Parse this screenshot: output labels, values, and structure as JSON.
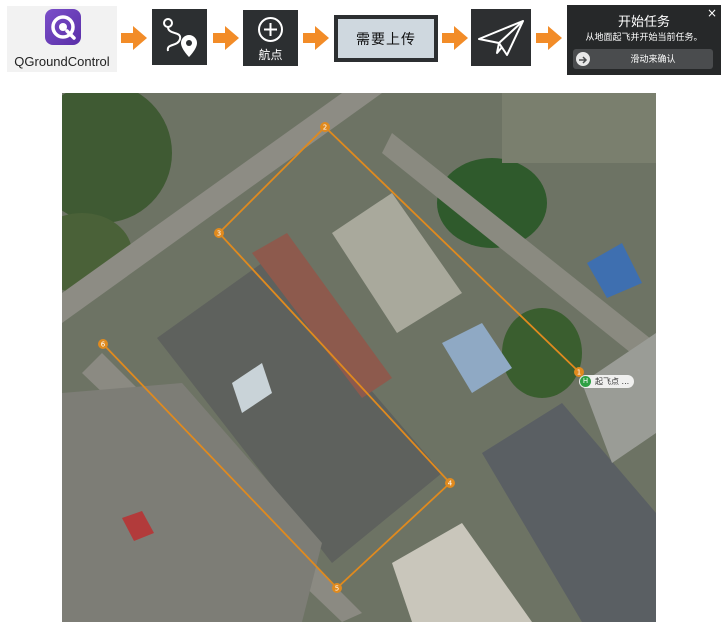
{
  "steps": {
    "app_name": "QGroundControl",
    "waypoint_label": "航点",
    "upload_label": "需要上传",
    "start_panel": {
      "title": "开始任务",
      "subtitle": "从地面起飞并开始当前任务。",
      "slider_label": "滑动来确认",
      "close_glyph": "×"
    }
  },
  "icons": {
    "app_logo": "qgroundcontrol-logo",
    "arrow": "arrow-right-icon",
    "plan": "route-plan-icon",
    "add_waypoint": "plus-circle-icon",
    "fly": "paper-plane-icon",
    "slider_knob": "arrow-right-circle-icon"
  },
  "colors": {
    "arrow": "#f28c28",
    "route": "#e08a1e",
    "tile_bg": "#2c2f31",
    "upload_button": "#cfd8df",
    "home_marker": "#2ea043"
  },
  "map": {
    "waypoints": [
      "1",
      "2",
      "3",
      "4",
      "5",
      "6"
    ],
    "home_marker_glyph": "H",
    "home_label": "",
    "home_label_blurred": "起飞点 ..."
  }
}
